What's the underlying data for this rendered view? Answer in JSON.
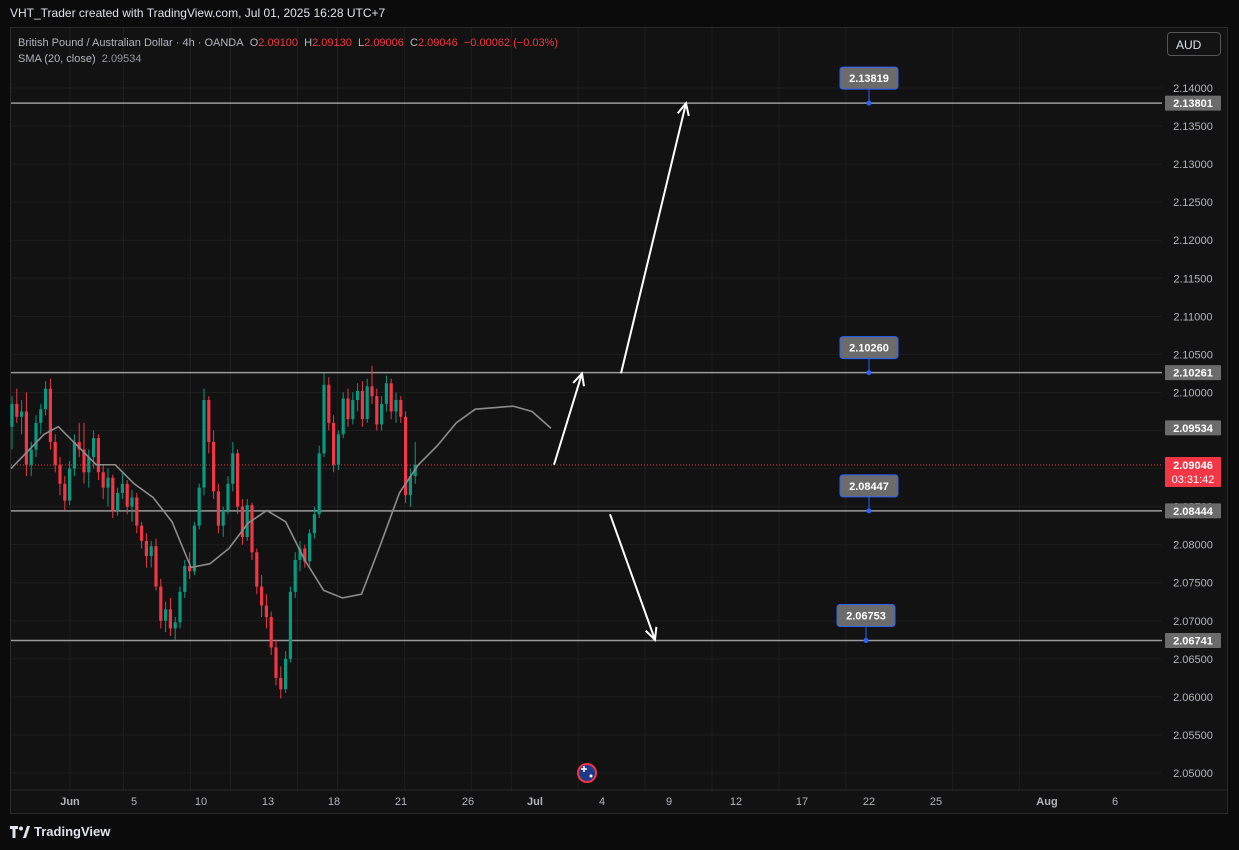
{
  "credit": "VHT_Trader created with TradingView.com, Jul 01, 2025 16:28 UTC+7",
  "legend": {
    "symbol": "British Pound / Australian Dollar · 4h · OANDA",
    "o_label": "O",
    "o_value": "2.09100",
    "h_label": "H",
    "h_value": "2.09130",
    "l_label": "L",
    "l_value": "2.09006",
    "c_label": "C",
    "c_value": "2.09046",
    "change": "−0.00062 (−0.03%)",
    "sma_label": "SMA (20, close)",
    "sma_value": "2.09534"
  },
  "currency_button": "AUD",
  "footer_brand": "TradingView",
  "colors": {
    "up": "#089981",
    "down": "#f23645",
    "line": "#8c8c8c",
    "label_blue": "#2962ff",
    "price_red": "#f23645"
  },
  "chart_data": {
    "type": "candlestick",
    "symbol": "GBPAUD",
    "timeframe": "4h",
    "y_ticks": [
      "2.14000",
      "2.13500",
      "2.13000",
      "2.12500",
      "2.12000",
      "2.11500",
      "2.11000",
      "2.10500",
      "2.10000",
      "2.09500",
      "2.09000",
      "2.08500",
      "2.08000",
      "2.07500",
      "2.07000",
      "2.06500",
      "2.06000",
      "2.05500",
      "2.05000"
    ],
    "ylim": [
      2.0484,
      2.1502
    ],
    "x_ticks": [
      {
        "label": "Jun",
        "bold": true,
        "day": 1
      },
      {
        "label": "5",
        "day": 5
      },
      {
        "label": "10",
        "day": 10
      },
      {
        "label": "13",
        "day": 13
      },
      {
        "label": "18",
        "day": 18
      },
      {
        "label": "21",
        "day": 21
      },
      {
        "label": "26",
        "day": 26
      },
      {
        "label": "Jul",
        "bold": true,
        "day": 31
      },
      {
        "label": "4",
        "day": 34
      },
      {
        "label": "9",
        "day": 39
      },
      {
        "label": "12",
        "day": 44
      },
      {
        "label": "17",
        "day": 49
      },
      {
        "label": "22",
        "day": 54
      },
      {
        "label": "25",
        "day": 59
      },
      {
        "label": "Aug",
        "bold": true,
        "day": 67
      },
      {
        "label": "6",
        "day": 72
      }
    ],
    "horizontal_levels": [
      {
        "price": 2.13801,
        "axis_label": "2.13801",
        "callout": "2.13819"
      },
      {
        "price": 2.10261,
        "axis_label": "2.10261",
        "callout": "2.10260"
      },
      {
        "price": 2.08444,
        "axis_label": "2.08444",
        "callout": "2.08447"
      },
      {
        "price": 2.06741,
        "axis_label": "2.06741",
        "callout": "2.06753"
      }
    ],
    "sma_axis_label": "2.09534",
    "current_price": {
      "price": 2.09046,
      "label": "2.09046",
      "countdown": "03:31:42"
    },
    "candles": [
      [
        2.0955,
        2.0995,
        2.0925,
        2.0985
      ],
      [
        2.0985,
        2.1005,
        2.096,
        2.0968
      ],
      [
        2.0968,
        2.099,
        2.0945,
        2.0975
      ],
      [
        2.0975,
        2.1,
        2.089,
        2.0905
      ],
      [
        2.0905,
        2.0935,
        2.089,
        2.0925
      ],
      [
        2.0925,
        2.097,
        2.0915,
        2.096
      ],
      [
        2.096,
        2.0985,
        2.0945,
        2.0978
      ],
      [
        2.0978,
        2.1015,
        2.097,
        2.1005
      ],
      [
        2.1005,
        2.1018,
        2.0925,
        2.0935
      ],
      [
        2.0935,
        2.0945,
        2.0895,
        2.0905
      ],
      [
        2.0905,
        2.0915,
        2.0865,
        2.088
      ],
      [
        2.088,
        2.089,
        2.0845,
        2.0858
      ],
      [
        2.0858,
        2.091,
        2.0852,
        2.09
      ],
      [
        2.09,
        2.0945,
        2.089,
        2.0935
      ],
      [
        2.0935,
        2.096,
        2.0915,
        2.0925
      ],
      [
        2.0925,
        2.096,
        2.088,
        2.0895
      ],
      [
        2.0895,
        2.0925,
        2.0875,
        2.0915
      ],
      [
        2.0915,
        2.095,
        2.09,
        2.094
      ],
      [
        2.094,
        2.0945,
        2.0885,
        2.0895
      ],
      [
        2.0895,
        2.0905,
        2.086,
        2.0875
      ],
      [
        2.0875,
        2.09,
        2.085,
        2.0888
      ],
      [
        2.0888,
        2.0892,
        2.0835,
        2.0845
      ],
      [
        2.0845,
        2.0875,
        2.0838,
        2.0868
      ],
      [
        2.0868,
        2.0895,
        2.086,
        2.088
      ],
      [
        2.088,
        2.0885,
        2.084,
        2.085
      ],
      [
        2.085,
        2.0872,
        2.083,
        2.0862
      ],
      [
        2.0862,
        2.0868,
        2.0815,
        2.0825
      ],
      [
        2.0825,
        2.083,
        2.0795,
        2.0805
      ],
      [
        2.0805,
        2.0815,
        2.077,
        2.0785
      ],
      [
        2.0785,
        2.0805,
        2.077,
        2.0798
      ],
      [
        2.0798,
        2.0808,
        2.074,
        2.0745
      ],
      [
        2.0745,
        2.0755,
        2.069,
        2.07
      ],
      [
        2.07,
        2.0725,
        2.0685,
        2.0715
      ],
      [
        2.0715,
        2.073,
        2.068,
        2.069
      ],
      [
        2.069,
        2.0705,
        2.0675,
        2.0698
      ],
      [
        2.0698,
        2.0745,
        2.069,
        2.0738
      ],
      [
        2.0738,
        2.078,
        2.073,
        2.0772
      ],
      [
        2.0772,
        2.079,
        2.0755,
        2.0765
      ],
      [
        2.0765,
        2.083,
        2.076,
        2.0825
      ],
      [
        2.0825,
        2.088,
        2.082,
        2.0875
      ],
      [
        2.0875,
        2.1005,
        2.0865,
        2.099
      ],
      [
        2.099,
        2.0995,
        2.092,
        2.0935
      ],
      [
        2.0935,
        2.095,
        2.086,
        2.087
      ],
      [
        2.087,
        2.088,
        2.0815,
        2.0825
      ],
      [
        2.0825,
        2.085,
        2.081,
        2.0845
      ],
      [
        2.0845,
        2.089,
        2.084,
        2.088
      ],
      [
        2.088,
        2.0935,
        2.087,
        2.092
      ],
      [
        2.092,
        2.0925,
        2.084,
        2.085
      ],
      [
        2.085,
        2.086,
        2.08,
        2.081
      ],
      [
        2.081,
        2.086,
        2.0805,
        2.0852
      ],
      [
        2.0852,
        2.0855,
        2.078,
        2.079
      ],
      [
        2.079,
        2.0795,
        2.0735,
        2.0745
      ],
      [
        2.0745,
        2.076,
        2.0705,
        2.072
      ],
      [
        2.072,
        2.0735,
        2.069,
        2.0705
      ],
      [
        2.0705,
        2.0712,
        2.0655,
        2.0665
      ],
      [
        2.0665,
        2.0675,
        2.0615,
        2.0625
      ],
      [
        2.0625,
        2.064,
        2.0598,
        2.061
      ],
      [
        2.061,
        2.066,
        2.0605,
        2.065
      ],
      [
        2.065,
        2.0745,
        2.0645,
        2.0738
      ],
      [
        2.0738,
        2.079,
        2.073,
        2.078
      ],
      [
        2.078,
        2.0805,
        2.0765,
        2.0795
      ],
      [
        2.0795,
        2.08,
        2.077,
        2.0778
      ],
      [
        2.0778,
        2.082,
        2.0772,
        2.0815
      ],
      [
        2.0815,
        2.085,
        2.0808,
        2.084
      ],
      [
        2.084,
        2.093,
        2.0835,
        2.092
      ],
      [
        2.092,
        2.1025,
        2.0915,
        2.101
      ],
      [
        2.101,
        2.102,
        2.095,
        2.096
      ],
      [
        2.096,
        2.097,
        2.0895,
        2.0905
      ],
      [
        2.0905,
        2.095,
        2.0898,
        2.0945
      ],
      [
        2.0945,
        2.1,
        2.094,
        2.0992
      ],
      [
        2.0992,
        2.1005,
        2.0955,
        2.0965
      ],
      [
        2.0965,
        2.1,
        2.0958,
        2.099
      ],
      [
        2.099,
        2.1012,
        2.0975,
        2.1002
      ],
      [
        2.1002,
        2.1015,
        2.0955,
        2.0965
      ],
      [
        2.0965,
        2.1018,
        2.096,
        2.1008
      ],
      [
        2.1008,
        2.1035,
        2.0985,
        2.0995
      ],
      [
        2.0995,
        2.1005,
        2.095,
        2.0958
      ],
      [
        2.0958,
        2.0995,
        2.095,
        2.0985
      ],
      [
        2.0985,
        2.1022,
        2.0975,
        2.1012
      ],
      [
        2.1012,
        2.1018,
        2.0965,
        2.0975
      ],
      [
        2.0975,
        2.1,
        2.096,
        2.099
      ],
      [
        2.099,
        2.0995,
        2.096,
        2.0968
      ],
      [
        2.0968,
        2.0975,
        2.0855,
        2.0865
      ],
      [
        2.0865,
        2.09,
        2.085,
        2.089
      ],
      [
        2.089,
        2.0935,
        2.088,
        2.0905
      ]
    ],
    "sma": [
      [
        0,
        2.09
      ],
      [
        7,
        2.0945
      ],
      [
        10,
        2.0955
      ],
      [
        14,
        2.093
      ],
      [
        18,
        2.0905
      ],
      [
        22,
        2.0905
      ],
      [
        26,
        2.088
      ],
      [
        30,
        2.0862
      ],
      [
        34,
        2.083
      ],
      [
        38,
        2.077
      ],
      [
        42,
        2.0775
      ],
      [
        46,
        2.0795
      ],
      [
        50,
        2.0828
      ],
      [
        54,
        2.0845
      ],
      [
        58,
        2.083
      ],
      [
        62,
        2.078
      ],
      [
        66,
        2.074
      ],
      [
        70,
        2.073
      ],
      [
        74,
        2.0735
      ],
      [
        78,
        2.08
      ],
      [
        82,
        2.0868
      ],
      [
        86,
        2.0905
      ],
      [
        90,
        2.093
      ],
      [
        94,
        2.096
      ],
      [
        98,
        2.0978
      ],
      [
        102,
        2.098
      ],
      [
        106,
        2.0982
      ],
      [
        110,
        2.0975
      ],
      [
        114,
        2.0953
      ]
    ],
    "arrows": [
      {
        "from": [
          2.0905,
          "c"
        ],
        "to": [
          2.1025,
          "u"
        ]
      },
      {
        "from": [
          2.1025,
          "a"
        ],
        "to": [
          2.138,
          "b"
        ]
      },
      {
        "from": [
          2.084,
          "d"
        ],
        "to": [
          2.0675,
          "e"
        ]
      }
    ]
  }
}
